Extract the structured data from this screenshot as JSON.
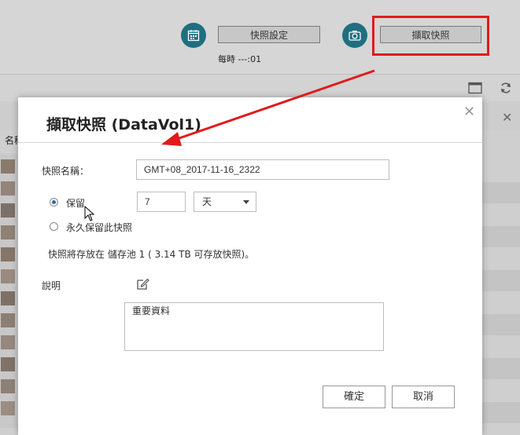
{
  "toolbar": {
    "snapshot_settings_label": "快照設定",
    "take_snapshot_label": "擷取快照",
    "schedule_text": "每時 ---:01"
  },
  "background": {
    "column_name_partial": "名稱"
  },
  "dialog": {
    "title": "擷取快照 (DataVol1)",
    "close_icon": "close-icon",
    "name_label": "快照名稱：",
    "name_value": "GMT+08_2017-11-16_2322",
    "retain_label": "保留",
    "retain_value": "7",
    "retain_unit": "天",
    "retain_forever_label": "永久保留此快照",
    "storage_note": "快照將存放在 儲存池 1 ( 3.14 TB 可存放快照)。",
    "description_label": "說明",
    "description_value": "重要資料",
    "ok_label": "確定",
    "cancel_label": "取消"
  },
  "colors": {
    "accent": "#1f6f80",
    "highlight": "#e01b1b",
    "radio": "#2b6bb5"
  }
}
